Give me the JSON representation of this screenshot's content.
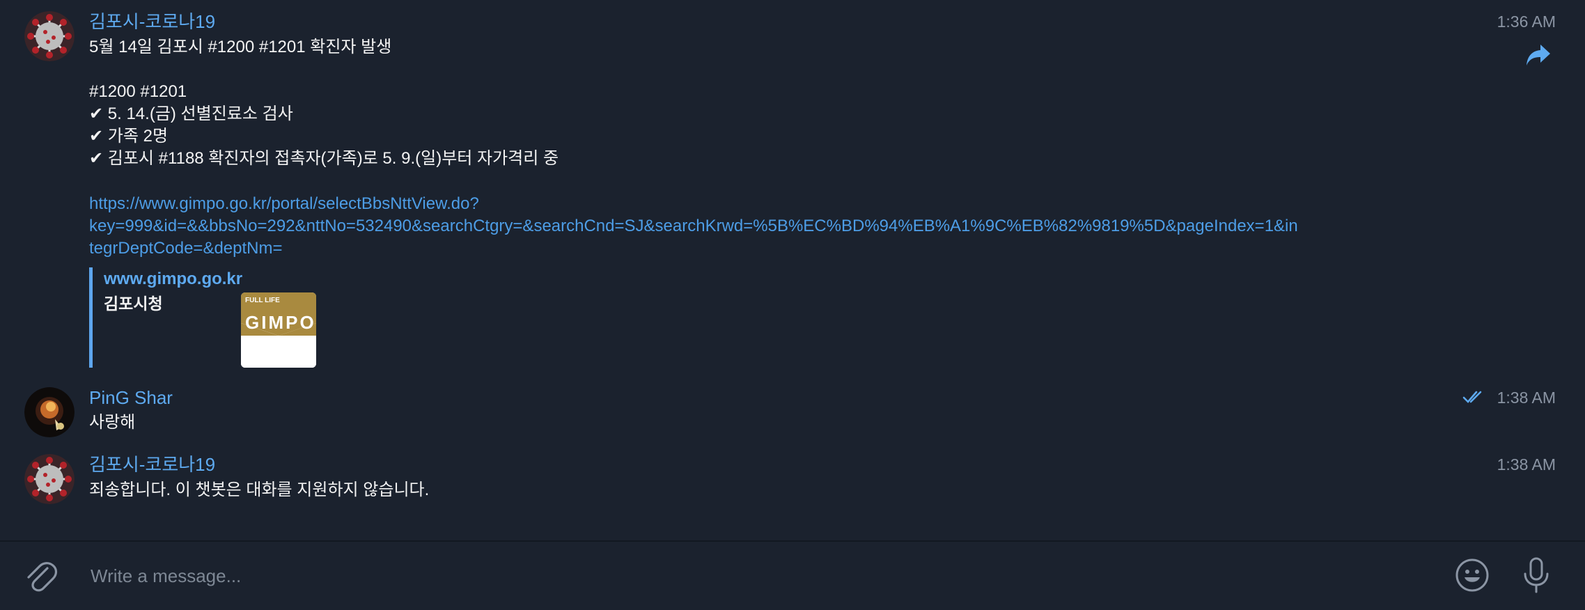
{
  "messages": [
    {
      "sender": "김포시-코로나19",
      "time": "1:36 AM",
      "lines": [
        "5월 14일 김포시 #1200 #1201 확진자 발생",
        "#1200 #1201",
        "✔ 5. 14.(금) 선별진료소 검사",
        "✔ 가족 2명",
        "✔ 김포시 #1188 확진자의 접촉자(가족)로 5. 9.(일)부터 자가격리 중"
      ],
      "link_lines": [
        "https://www.gimpo.go.kr/portal/selectBbsNttView.do?",
        "key=999&id=&&bbsNo=292&nttNo=532490&searchCtgry=&searchCnd=SJ&searchKrwd=%5B%EC%BD%94%EB%A1%9C%EB%82%9819%5D&pageIndex=1&in",
        "tegrDeptCode=&deptNm="
      ],
      "preview": {
        "site": "www.gimpo.go.kr",
        "title": "김포시청",
        "thumb_text_small": "FULL LIFE",
        "thumb_text_big": "GIMPO"
      }
    },
    {
      "sender": "PinG Shar",
      "time": "1:38 AM",
      "text": "사랑해",
      "status": "read"
    },
    {
      "sender": "김포시-코로나19",
      "time": "1:38 AM",
      "text": "죄송합니다. 이 챗봇은 대화를 지원하지 않습니다."
    }
  ],
  "composer": {
    "placeholder": "Write a message..."
  },
  "colors": {
    "background": "#1b222e",
    "accent": "#5eaaf0",
    "link": "#4d9de6",
    "time": "#8b95a4"
  },
  "icons": [
    "virus-avatar-icon",
    "forward-icon",
    "double-check-icon",
    "paperclip-icon",
    "emoji-icon",
    "microphone-icon"
  ]
}
